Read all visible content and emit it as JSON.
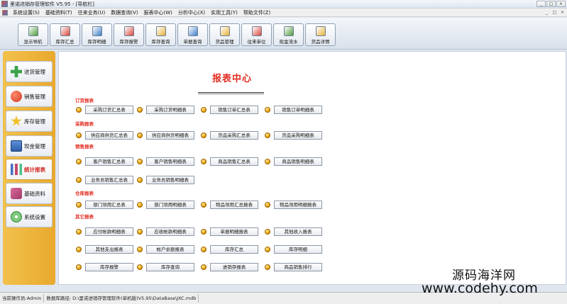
{
  "window": {
    "title": "里诺进销存管理软件 V5.95 - [导航栏]",
    "buttons": [
      "_",
      "□",
      "×"
    ]
  },
  "menubar": {
    "items": [
      "系统设置(S)",
      "基础资料(T)",
      "往来业务(U)",
      "数据查询(V)",
      "报表中心(W)",
      "分析中心(X)",
      "实用工具(Y)",
      "帮助文件(Z)"
    ],
    "mdi_buttons": [
      "_",
      "□",
      "×"
    ]
  },
  "toolbar": {
    "buttons": [
      {
        "label": "显示导航",
        "icon": "nav-icon",
        "color": "#4f9b3a"
      },
      {
        "label": "库存汇总",
        "icon": "summary-icon",
        "color": "#d9473a"
      },
      {
        "label": "库存明细",
        "icon": "detail-icon",
        "color": "#3d7fc9"
      },
      {
        "label": "库存报警",
        "icon": "alarm-icon",
        "color": "#d9473a"
      },
      {
        "label": "库存查询",
        "icon": "query-icon",
        "color": "#e6b23a"
      },
      {
        "label": "单据查询",
        "icon": "document-icon",
        "color": "#3d7fc9"
      },
      {
        "label": "货品管理",
        "icon": "goods-icon",
        "color": "#e6b23a"
      },
      {
        "label": "往来单位",
        "icon": "partner-icon",
        "color": "#d9473a"
      },
      {
        "label": "现金流水",
        "icon": "cash-icon",
        "color": "#4f9b3a"
      },
      {
        "label": "货品详情",
        "icon": "info-icon",
        "color": "#e6b23a"
      }
    ]
  },
  "sidebar": {
    "items": [
      {
        "label": "进货管理",
        "icon": "plus-icon",
        "active": false
      },
      {
        "label": "销售管理",
        "icon": "globe-icon",
        "active": false
      },
      {
        "label": "库存管理",
        "icon": "star-icon",
        "active": false
      },
      {
        "label": "现金管理",
        "icon": "cash-register-icon",
        "active": false
      },
      {
        "label": "统计报表",
        "icon": "bar-chart-icon",
        "active": true
      },
      {
        "label": "基础资料",
        "icon": "tools-icon",
        "active": false
      },
      {
        "label": "系统设置",
        "icon": "cd-icon",
        "active": false
      }
    ]
  },
  "main": {
    "title": "报表中心",
    "sections": [
      {
        "label": "订货报表",
        "rows": [
          [
            "采购订货汇总表",
            "采购订货明细表",
            "销售订单汇总表",
            "销售订单明细表"
          ]
        ]
      },
      {
        "label": "采购报表",
        "rows": [
          [
            "供应商供货汇总表",
            "供应商供货明细表",
            "货品采购汇总表",
            "货品采购明细表"
          ]
        ]
      },
      {
        "label": "销售报表",
        "rows": [
          [
            "客户销售汇总表",
            "客户销售明细表",
            "商品销售汇总表",
            "商品销售明细表"
          ],
          [
            "业务员销售汇总表",
            "业务员销售明细表"
          ]
        ]
      },
      {
        "label": "仓库报表",
        "rows": [
          [
            "部门领用汇总表",
            "部门领用明细表",
            "物品领用汇总报表",
            "物品领用明细报表"
          ]
        ]
      },
      {
        "label": "其它报表",
        "rows": [
          [
            "应付帐款明细表",
            "应收帐款明细表",
            "单据明细报表",
            "其他收入报表"
          ],
          [
            "其他支出报表",
            "帐户余额报表",
            "库存汇总",
            "库存明细"
          ],
          [
            "库存报警",
            "库存查询",
            "进销存报表",
            "商品销售排行"
          ]
        ]
      }
    ]
  },
  "statusbar": {
    "operator": "当前操作员:Admin",
    "db_path": "数据库路径: D:\\里诺进销存管理软件(单机版)V5.95\\DataBase\\JXC.mdb"
  },
  "watermark": {
    "line1": "源码海洋网",
    "line2": "www.codehy.com"
  }
}
